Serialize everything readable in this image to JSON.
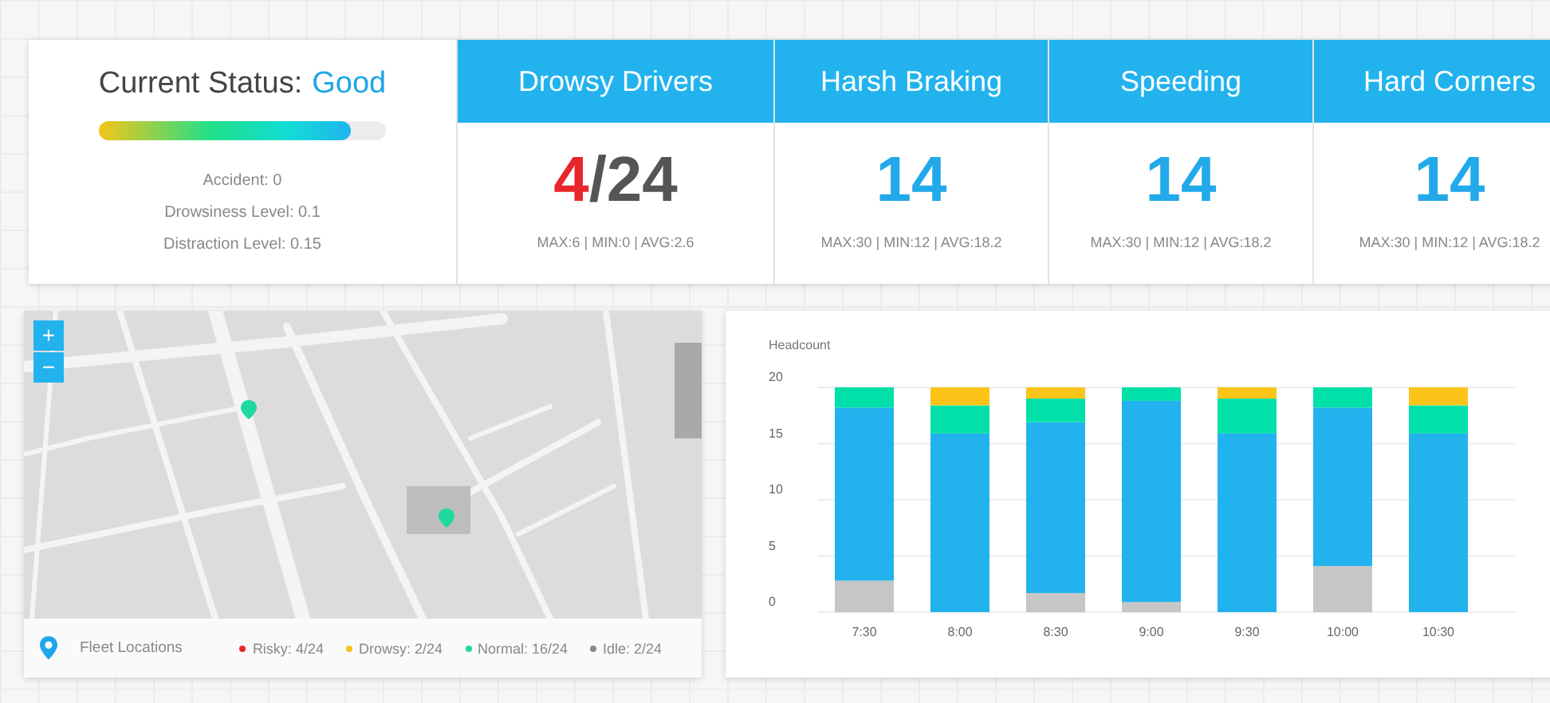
{
  "status": {
    "label": "Current Status:",
    "value": "Good",
    "level": 0.88,
    "details": [
      "Accident: 0",
      "Drowsiness Level: 0.1",
      "Distraction Level: 0.15"
    ]
  },
  "metrics": [
    {
      "title": "Drowsy Drivers",
      "kind": "ratio",
      "highlight": "4",
      "value": "/24",
      "stats": "MAX:6 | MIN:0 | AVG:2.6"
    },
    {
      "title": "Harsh Braking",
      "kind": "count",
      "value": "14",
      "stats": "MAX:30 | MIN:12 | AVG:18.2"
    },
    {
      "title": "Speeding",
      "kind": "count",
      "value": "14",
      "stats": "MAX:30 | MIN:12 | AVG:18.2"
    },
    {
      "title": "Hard Corners",
      "kind": "count",
      "value": "14",
      "stats": "MAX:30 | MIN:12 | AVG:18.2"
    }
  ],
  "map": {
    "zoom_in": "+",
    "zoom_out": "−",
    "footer_title": "Fleet Locations",
    "legend": [
      {
        "label": "Risky: 4/24",
        "color": "#e8262b"
      },
      {
        "label": "Drowsy: 2/24",
        "color": "#f5c518"
      },
      {
        "label": "Normal: 16/24",
        "color": "#1fd8a0"
      },
      {
        "label": "Idle: 2/24",
        "color": "#8a8a8a"
      }
    ]
  },
  "chart_data": {
    "type": "bar",
    "stacked": true,
    "grid": true,
    "ylabel": "Headcount",
    "categories": [
      "7:30",
      "8:00",
      "8:30",
      "9:00",
      "9:30",
      "10:00",
      "10:30"
    ],
    "ylim": [
      0,
      20
    ],
    "yticks": [
      0,
      5,
      10,
      15,
      20
    ],
    "series": [
      {
        "color": "#c6c6c6",
        "values": [
          2.8,
          0,
          1.7,
          0.9,
          0,
          4.1,
          0
        ]
      },
      {
        "color": "#22b3ee",
        "values": [
          15.4,
          15.9,
          15.2,
          17.9,
          15.9,
          14.1,
          15.9
        ]
      },
      {
        "color": "#00e0a8",
        "values": [
          1.8,
          2.5,
          2.1,
          1.2,
          3.1,
          1.8,
          2.5
        ]
      },
      {
        "color": "#fcc419",
        "values": [
          0,
          1.6,
          1.0,
          0,
          1.0,
          0,
          1.6
        ]
      }
    ]
  }
}
